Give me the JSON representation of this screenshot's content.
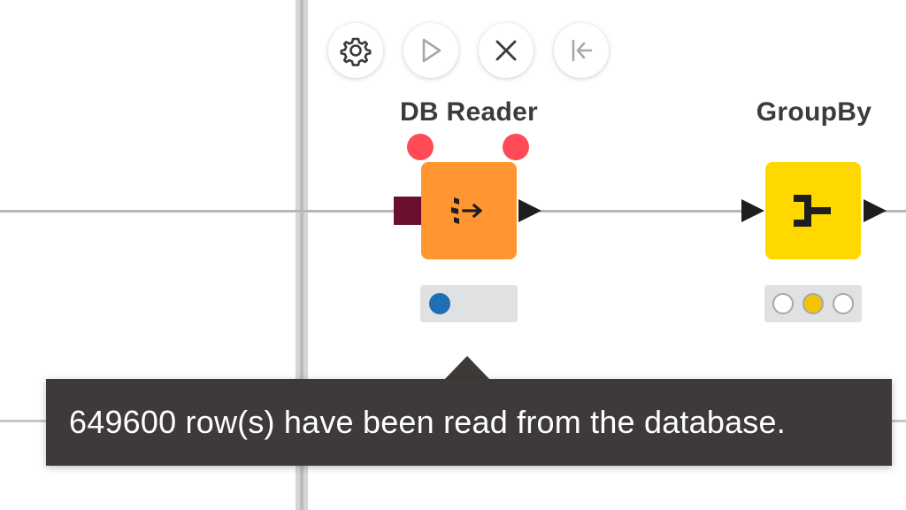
{
  "nodes": [
    {
      "label": "DB Reader",
      "color": "#ff9632",
      "icon": "db-reader-icon",
      "status": "warning",
      "traffic_light": "executed (blue)"
    },
    {
      "label": "GroupBy",
      "color": "#ffd800",
      "icon": "groupby-icon",
      "status": "configured",
      "traffic_light": "configured (yellow)"
    }
  ],
  "action_bar": {
    "configure": "gear-icon",
    "execute": "play-icon",
    "cancel": "close-icon",
    "reset": "reset-icon"
  },
  "tooltip": {
    "text": "649600 row(s) have been read from the database."
  },
  "colors": {
    "warning": "#ff4b58",
    "db_port": "#6b0f2e",
    "status_blue": "#1f6fb5",
    "status_yellow": "#f5c400",
    "tooltip_bg": "#3e3a39"
  }
}
